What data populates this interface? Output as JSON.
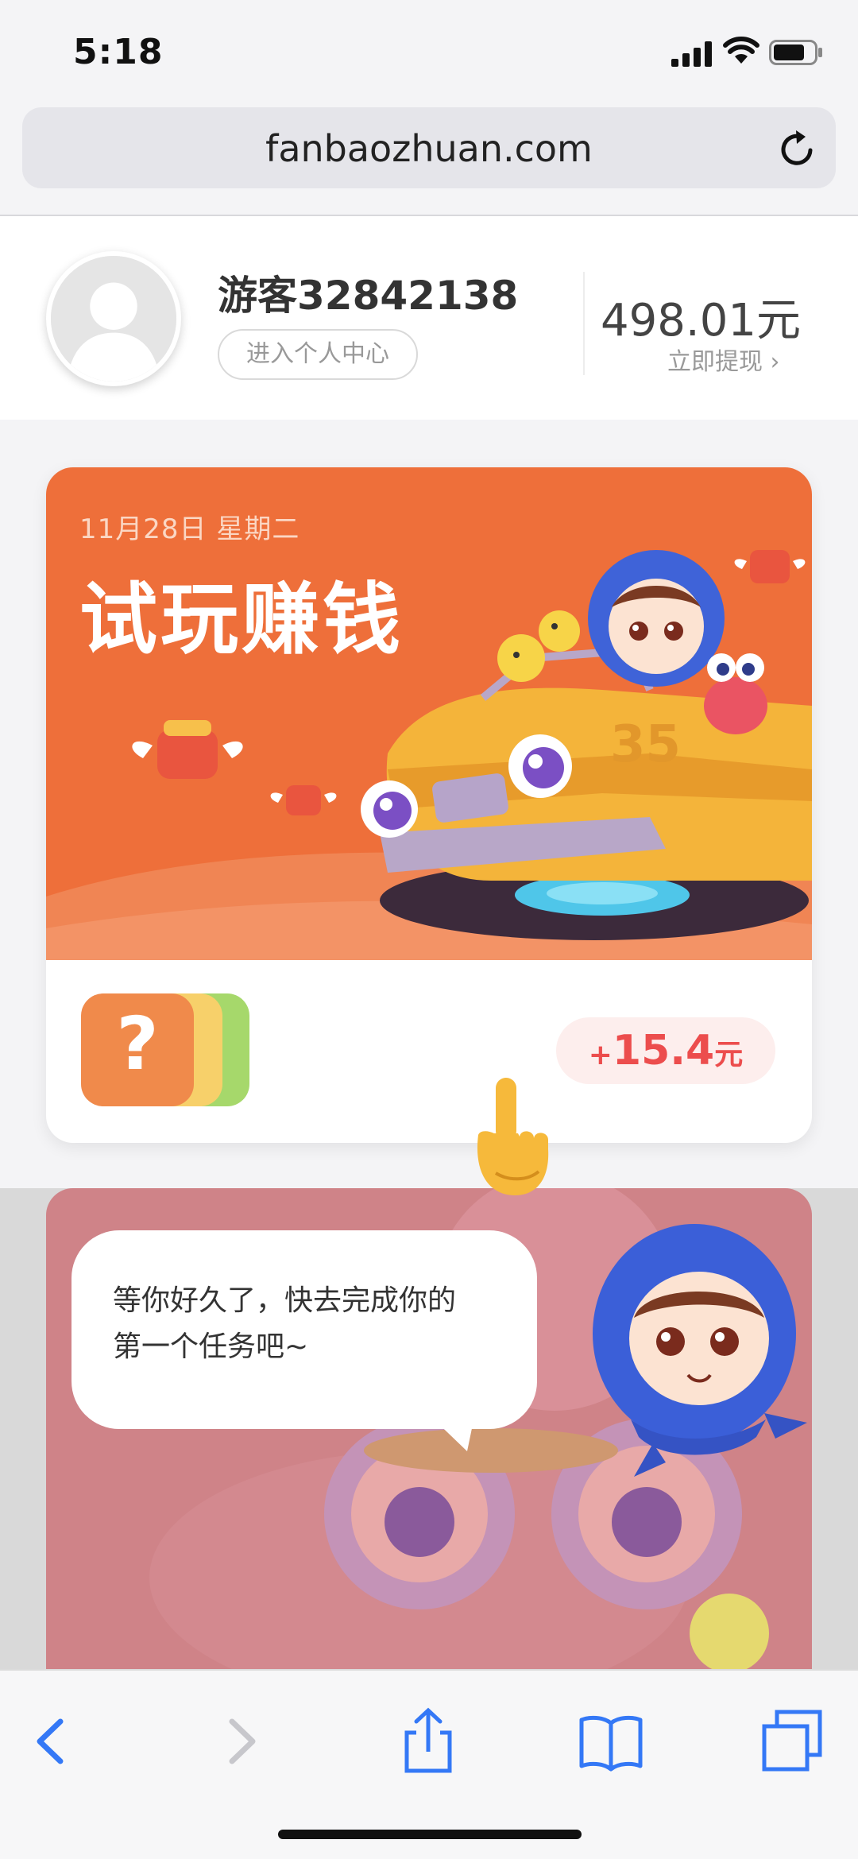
{
  "status_bar": {
    "time": "5:18"
  },
  "browser": {
    "url": "fanbaozhuan.com"
  },
  "profile": {
    "username": "游客32842138",
    "center_button": "进入个人中心",
    "balance": "498.01元",
    "withdraw": "立即提现 ›"
  },
  "task_card": {
    "date": "11月28日 星期二",
    "title": "试玩赚钱",
    "reward_sign": "+",
    "reward_amount": "15.4",
    "reward_unit": "元",
    "app_icon_glyph": "?"
  },
  "tooltip": {
    "line1": "等你好久了，快去完成你的",
    "line2": "第一个任务吧~"
  },
  "colors": {
    "accent_orange": "#ee6f3a",
    "reward_red": "#ec4d4d",
    "ios_blue": "#3478f6"
  },
  "icons": [
    "signal-icon",
    "wifi-icon",
    "battery-icon",
    "reload-icon",
    "back-icon",
    "forward-icon",
    "share-icon",
    "bookmarks-icon",
    "tabs-icon",
    "pointing-hand-icon",
    "mascot-icon"
  ]
}
